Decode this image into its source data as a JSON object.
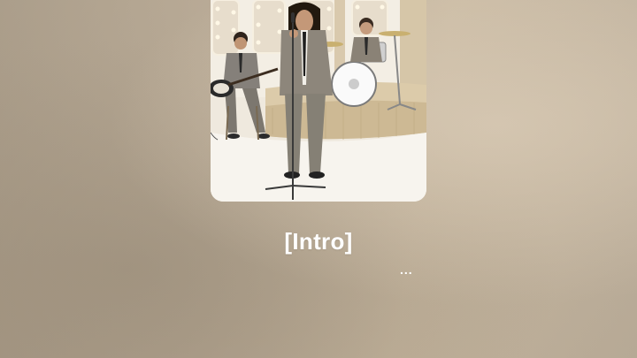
{
  "lyrics": {
    "current_line": "[Intro]",
    "next_indicator": "..."
  },
  "artwork": {
    "description_icon": "album-artwork"
  },
  "colors": {
    "background": "#b8a994",
    "lyric_text": "#ffffff"
  }
}
